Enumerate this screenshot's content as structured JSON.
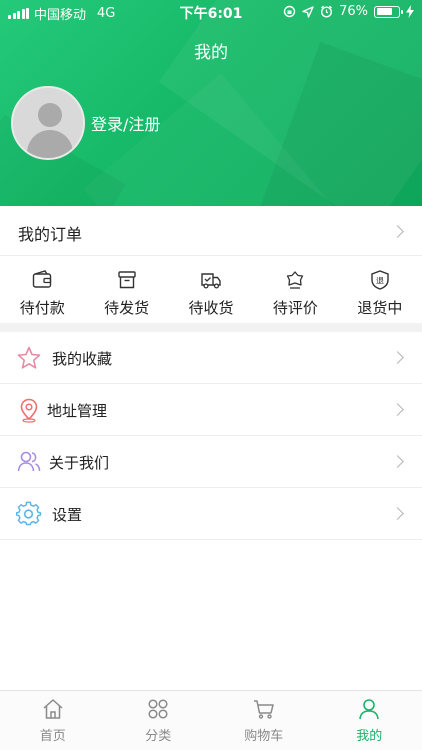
{
  "status_bar": {
    "carrier": "中国移动",
    "network": "4G",
    "time": "下午6:01",
    "battery": "76%",
    "battery_level": 0.76
  },
  "header": {
    "title": "我的",
    "login_label": "登录/注册"
  },
  "orders": {
    "label": "我的订单",
    "statuses": [
      {
        "label": "待付款",
        "icon": "wallet-icon"
      },
      {
        "label": "待发货",
        "icon": "box-icon"
      },
      {
        "label": "待收货",
        "icon": "truck-icon"
      },
      {
        "label": "待评价",
        "icon": "review-icon"
      },
      {
        "label": "退货中",
        "icon": "return-shield-icon"
      }
    ]
  },
  "menu": [
    {
      "label": "我的收藏",
      "icon": "star-icon",
      "color": "#e88aa6"
    },
    {
      "label": "地址管理",
      "icon": "location-pin-icon",
      "color": "#f06d6d"
    },
    {
      "label": "关于我们",
      "icon": "users-icon",
      "color": "#a98be6"
    },
    {
      "label": "设置",
      "icon": "gear-icon",
      "color": "#5cb4e8"
    }
  ],
  "tabbar": {
    "items": [
      {
        "label": "首页",
        "icon": "home-icon"
      },
      {
        "label": "分类",
        "icon": "category-icon"
      },
      {
        "label": "购物车",
        "icon": "cart-icon"
      },
      {
        "label": "我的",
        "icon": "user-icon"
      }
    ],
    "active_index": 3,
    "active_color": "#1db36a"
  },
  "colors": {
    "brand": "#16b967"
  }
}
